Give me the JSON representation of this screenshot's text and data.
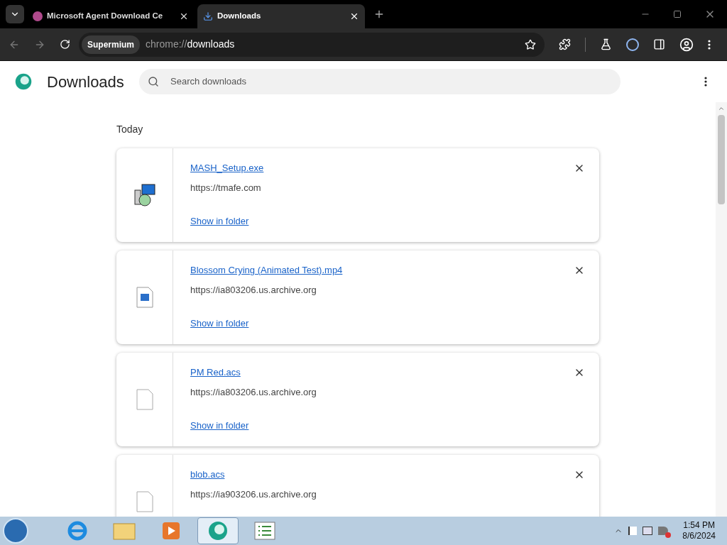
{
  "tabs": [
    {
      "title": "Microsoft Agent Download Ce",
      "selected": false
    },
    {
      "title": "Downloads",
      "selected": true
    }
  ],
  "toolbar": {
    "badge": "Supermium",
    "url_scheme": "chrome://",
    "url_path": "downloads"
  },
  "page": {
    "title": "Downloads",
    "search": {
      "placeholder": "Search downloads"
    }
  },
  "section": "Today",
  "downloads": [
    {
      "kind": "installer",
      "name": "MASH_Setup.exe",
      "source": "https://tmafe.com",
      "action": "Show in folder"
    },
    {
      "kind": "video",
      "name": "Blossom Crying (Animated Test).mp4",
      "source": "https://ia803206.us.archive.org",
      "action": "Show in folder"
    },
    {
      "kind": "file",
      "name": "PM Red.acs",
      "source": "https://ia803206.us.archive.org",
      "action": "Show in folder"
    },
    {
      "kind": "file",
      "name": "blob.acs",
      "source": "https://ia903206.us.archive.org"
    }
  ],
  "taskbar": {
    "apps": [
      {
        "kind": "ie",
        "selected": false
      },
      {
        "kind": "folder",
        "selected": false
      },
      {
        "kind": "media",
        "selected": false
      },
      {
        "kind": "browser",
        "selected": true
      },
      {
        "kind": "list",
        "selected": false
      }
    ],
    "time": "1:54 PM",
    "date": "8/6/2024"
  }
}
